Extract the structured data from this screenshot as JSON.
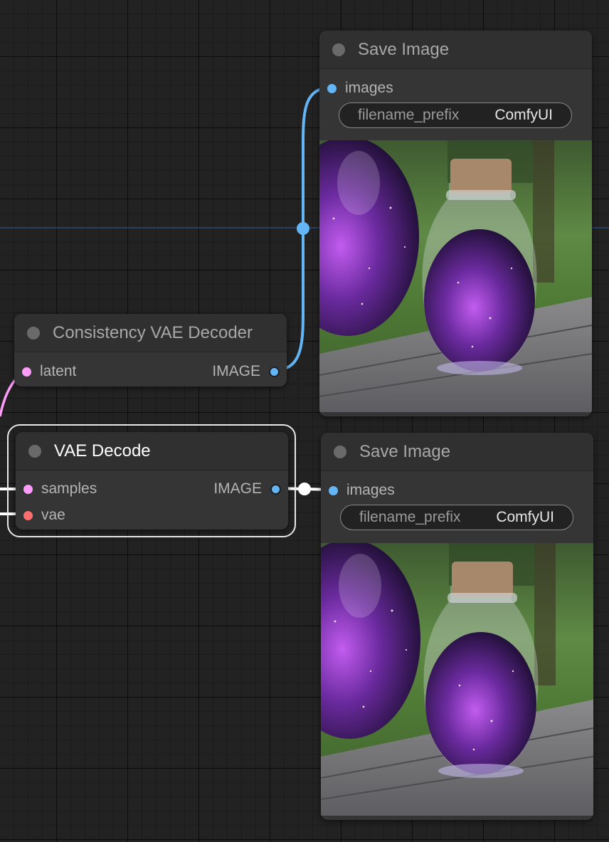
{
  "nodes": {
    "save_image_top": {
      "title": "Save Image",
      "input_label": "images",
      "widget": {
        "name": "filename_prefix",
        "value": "ComfyUI"
      }
    },
    "consistency_vae_decoder": {
      "title": "Consistency VAE Decoder",
      "input_label": "latent",
      "output_label": "IMAGE"
    },
    "vae_decode": {
      "title": "VAE Decode",
      "inputs": [
        "samples",
        "vae"
      ],
      "output_label": "IMAGE",
      "selected": true
    },
    "save_image_bottom": {
      "title": "Save Image",
      "input_label": "images",
      "widget": {
        "name": "filename_prefix",
        "value": "ComfyUI"
      }
    }
  },
  "colors": {
    "canvas": "#222222",
    "node_body": "#353535",
    "node_header": "#303030",
    "latent_slot": "#ff9cf9",
    "image_slot": "#64b5f6",
    "vae_slot": "#ff6e6e",
    "image_wire": "#64b5f6",
    "latent_wire": "#ff9cf9",
    "selection": "#e8e8e8"
  },
  "icons": {
    "node_collapse": "collapse-dot-icon",
    "wire_reroute": "reroute-dot-icon"
  }
}
